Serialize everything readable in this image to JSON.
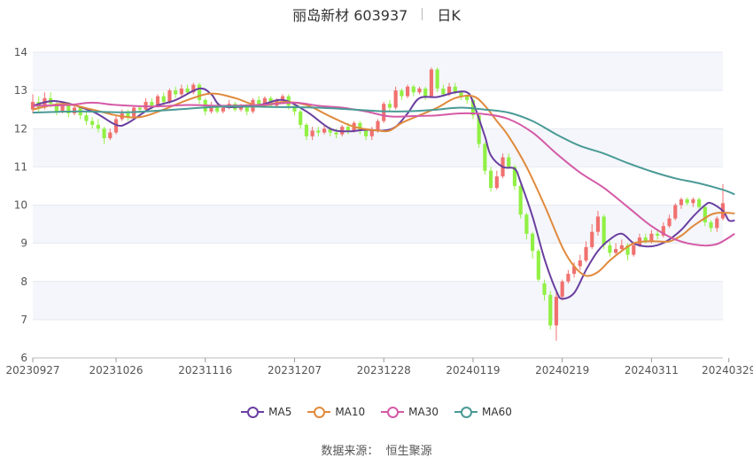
{
  "header": {
    "name": "丽岛新材 603937",
    "period": "日K"
  },
  "source": {
    "label": "数据来源：",
    "value": "恒生聚源"
  },
  "colors": {
    "up": "#f0716f",
    "down": "#91f044",
    "grid": "#e6e9f0",
    "band": "#f4f6fb"
  },
  "chart_data": {
    "type": "candlestick",
    "title": "丽岛新材 603937",
    "ylim": [
      6,
      14
    ],
    "yticks": [
      6,
      7,
      8,
      9,
      10,
      11,
      12,
      13,
      14
    ],
    "x_ticks": [
      "20230927",
      "20231026",
      "20231116",
      "20231207",
      "20231228",
      "20240119",
      "20240219",
      "20240311",
      "20240329"
    ],
    "x_tick_index": [
      0,
      14,
      29,
      44,
      59,
      74,
      89,
      104,
      117
    ],
    "ma_lines": [
      {
        "name": "MA5",
        "color": "#6a3fa0",
        "anchors": [
          [
            0,
            12.6
          ],
          [
            4,
            12.72
          ],
          [
            10,
            12.45
          ],
          [
            14,
            12.1
          ],
          [
            16,
            12.15
          ],
          [
            20,
            12.55
          ],
          [
            24,
            12.75
          ],
          [
            28,
            13.05
          ],
          [
            30,
            12.9
          ],
          [
            32,
            12.58
          ],
          [
            38,
            12.62
          ],
          [
            42,
            12.75
          ],
          [
            46,
            12.45
          ],
          [
            50,
            12.0
          ],
          [
            53,
            11.93
          ],
          [
            56,
            11.97
          ],
          [
            59,
            11.95
          ],
          [
            61,
            12.05
          ],
          [
            63,
            12.4
          ],
          [
            65,
            12.8
          ],
          [
            68,
            12.83
          ],
          [
            71,
            12.95
          ],
          [
            73,
            12.95
          ],
          [
            74,
            12.7
          ],
          [
            76,
            11.8
          ],
          [
            77,
            11.3
          ],
          [
            79,
            11.0
          ],
          [
            81,
            10.95
          ],
          [
            82,
            10.6
          ],
          [
            84,
            9.7
          ],
          [
            86,
            8.6
          ],
          [
            88,
            7.75
          ],
          [
            89,
            7.55
          ],
          [
            91,
            7.7
          ],
          [
            93,
            8.3
          ],
          [
            95,
            8.8
          ],
          [
            97,
            9.1
          ],
          [
            99,
            9.25
          ],
          [
            101,
            9.0
          ],
          [
            103,
            8.92
          ],
          [
            105,
            8.95
          ],
          [
            107,
            9.1
          ],
          [
            109,
            9.35
          ],
          [
            111,
            9.7
          ],
          [
            113,
            10.0
          ],
          [
            114,
            10.05
          ],
          [
            116,
            9.85
          ],
          [
            117,
            9.6
          ],
          [
            118,
            9.6
          ]
        ]
      },
      {
        "name": "MA10",
        "color": "#e08a3c",
        "anchors": [
          [
            0,
            12.5
          ],
          [
            5,
            12.65
          ],
          [
            10,
            12.5
          ],
          [
            14,
            12.35
          ],
          [
            18,
            12.3
          ],
          [
            22,
            12.5
          ],
          [
            26,
            12.75
          ],
          [
            30,
            12.92
          ],
          [
            34,
            12.8
          ],
          [
            38,
            12.6
          ],
          [
            42,
            12.7
          ],
          [
            46,
            12.62
          ],
          [
            50,
            12.32
          ],
          [
            54,
            12.05
          ],
          [
            58,
            11.95
          ],
          [
            60,
            11.95
          ],
          [
            62,
            12.15
          ],
          [
            65,
            12.35
          ],
          [
            68,
            12.55
          ],
          [
            71,
            12.8
          ],
          [
            74,
            12.85
          ],
          [
            76,
            12.6
          ],
          [
            78,
            12.2
          ],
          [
            80,
            11.8
          ],
          [
            83,
            11.0
          ],
          [
            86,
            10.0
          ],
          [
            89,
            8.9
          ],
          [
            91,
            8.4
          ],
          [
            93,
            8.15
          ],
          [
            95,
            8.25
          ],
          [
            97,
            8.55
          ],
          [
            99,
            8.8
          ],
          [
            101,
            9.0
          ],
          [
            103,
            9.05
          ],
          [
            105,
            9.05
          ],
          [
            107,
            9.05
          ],
          [
            109,
            9.2
          ],
          [
            111,
            9.45
          ],
          [
            114,
            9.75
          ],
          [
            116,
            9.8
          ],
          [
            118,
            9.78
          ]
        ]
      },
      {
        "name": "MA30",
        "color": "#d45aa6",
        "anchors": [
          [
            0,
            12.6
          ],
          [
            6,
            12.62
          ],
          [
            10,
            12.68
          ],
          [
            14,
            12.62
          ],
          [
            20,
            12.58
          ],
          [
            26,
            12.62
          ],
          [
            32,
            12.6
          ],
          [
            38,
            12.62
          ],
          [
            44,
            12.68
          ],
          [
            48,
            12.6
          ],
          [
            52,
            12.55
          ],
          [
            56,
            12.45
          ],
          [
            60,
            12.32
          ],
          [
            64,
            12.33
          ],
          [
            68,
            12.35
          ],
          [
            72,
            12.4
          ],
          [
            76,
            12.38
          ],
          [
            80,
            12.25
          ],
          [
            84,
            11.9
          ],
          [
            88,
            11.35
          ],
          [
            92,
            10.85
          ],
          [
            96,
            10.45
          ],
          [
            100,
            9.95
          ],
          [
            104,
            9.45
          ],
          [
            108,
            9.1
          ],
          [
            112,
            8.95
          ],
          [
            115,
            8.98
          ],
          [
            118,
            9.25
          ]
        ]
      },
      {
        "name": "MA60",
        "color": "#4a9a96",
        "anchors": [
          [
            0,
            12.42
          ],
          [
            8,
            12.45
          ],
          [
            16,
            12.43
          ],
          [
            24,
            12.5
          ],
          [
            32,
            12.58
          ],
          [
            40,
            12.57
          ],
          [
            48,
            12.55
          ],
          [
            56,
            12.48
          ],
          [
            60,
            12.45
          ],
          [
            64,
            12.46
          ],
          [
            68,
            12.5
          ],
          [
            72,
            12.55
          ],
          [
            76,
            12.5
          ],
          [
            80,
            12.42
          ],
          [
            84,
            12.2
          ],
          [
            88,
            11.85
          ],
          [
            92,
            11.55
          ],
          [
            96,
            11.35
          ],
          [
            100,
            11.1
          ],
          [
            104,
            10.88
          ],
          [
            108,
            10.7
          ],
          [
            112,
            10.57
          ],
          [
            116,
            10.4
          ],
          [
            118,
            10.28
          ]
        ]
      }
    ],
    "candles": [
      [
        12.5,
        12.7,
        12.9,
        12.4
      ],
      [
        12.7,
        12.55,
        12.85,
        12.4
      ],
      [
        12.55,
        12.8,
        12.95,
        12.5
      ],
      [
        12.8,
        12.65,
        12.95,
        12.55
      ],
      [
        12.65,
        12.45,
        12.75,
        12.35
      ],
      [
        12.45,
        12.6,
        12.7,
        12.4
      ],
      [
        12.6,
        12.4,
        12.7,
        12.3
      ],
      [
        12.4,
        12.55,
        12.65,
        12.35
      ],
      [
        12.55,
        12.35,
        12.6,
        12.25
      ],
      [
        12.35,
        12.2,
        12.45,
        12.1
      ],
      [
        12.2,
        12.1,
        12.3,
        12.0
      ],
      [
        12.1,
        12.0,
        12.25,
        11.9
      ],
      [
        12.0,
        11.75,
        12.05,
        11.6
      ],
      [
        11.75,
        11.9,
        12.0,
        11.7
      ],
      [
        11.9,
        12.25,
        12.35,
        11.85
      ],
      [
        12.25,
        12.4,
        12.5,
        12.2
      ],
      [
        12.4,
        12.3,
        12.5,
        12.2
      ],
      [
        12.3,
        12.55,
        12.6,
        12.25
      ],
      [
        12.55,
        12.5,
        12.6,
        12.4
      ],
      [
        12.5,
        12.7,
        12.8,
        12.45
      ],
      [
        12.7,
        12.6,
        12.8,
        12.5
      ],
      [
        12.6,
        12.85,
        12.9,
        12.55
      ],
      [
        12.85,
        12.7,
        12.95,
        12.6
      ],
      [
        12.7,
        13.0,
        13.05,
        12.65
      ],
      [
        13.0,
        12.9,
        13.1,
        12.8
      ],
      [
        12.9,
        13.05,
        13.15,
        12.85
      ],
      [
        13.05,
        12.95,
        13.15,
        12.9
      ],
      [
        12.95,
        13.15,
        13.2,
        12.9
      ],
      [
        13.15,
        12.75,
        13.2,
        12.65
      ],
      [
        12.75,
        12.45,
        12.8,
        12.35
      ],
      [
        12.45,
        12.6,
        12.7,
        12.4
      ],
      [
        12.6,
        12.45,
        12.7,
        12.4
      ],
      [
        12.45,
        12.55,
        12.6,
        12.4
      ],
      [
        12.55,
        12.65,
        12.75,
        12.5
      ],
      [
        12.65,
        12.5,
        12.7,
        12.45
      ],
      [
        12.5,
        12.6,
        12.65,
        12.45
      ],
      [
        12.6,
        12.45,
        12.65,
        12.35
      ],
      [
        12.45,
        12.75,
        12.8,
        12.4
      ],
      [
        12.75,
        12.6,
        12.85,
        12.55
      ],
      [
        12.6,
        12.8,
        12.85,
        12.55
      ],
      [
        12.8,
        12.6,
        12.85,
        12.55
      ],
      [
        12.6,
        12.75,
        12.8,
        12.55
      ],
      [
        12.75,
        12.85,
        12.9,
        12.7
      ],
      [
        12.85,
        12.6,
        12.9,
        12.5
      ],
      [
        12.6,
        12.45,
        12.7,
        12.35
      ],
      [
        12.45,
        12.1,
        12.5,
        12.0
      ],
      [
        12.1,
        11.8,
        12.15,
        11.7
      ],
      [
        11.8,
        11.95,
        12.05,
        11.7
      ],
      [
        11.95,
        11.9,
        12.05,
        11.8
      ],
      [
        11.9,
        12.0,
        12.1,
        11.85
      ],
      [
        12.0,
        11.9,
        12.05,
        11.8
      ],
      [
        11.9,
        11.85,
        12.0,
        11.75
      ],
      [
        11.85,
        12.05,
        12.1,
        11.8
      ],
      [
        12.05,
        11.95,
        12.15,
        11.85
      ],
      [
        11.95,
        12.15,
        12.2,
        11.9
      ],
      [
        12.15,
        11.95,
        12.2,
        11.85
      ],
      [
        11.95,
        11.8,
        12.0,
        11.7
      ],
      [
        11.8,
        11.95,
        12.05,
        11.7
      ],
      [
        11.95,
        12.2,
        12.25,
        11.9
      ],
      [
        12.2,
        12.65,
        12.7,
        12.15
      ],
      [
        12.65,
        12.55,
        12.75,
        12.45
      ],
      [
        12.55,
        13.0,
        13.1,
        12.5
      ],
      [
        13.0,
        12.85,
        13.05,
        12.75
      ],
      [
        12.85,
        13.1,
        13.15,
        12.8
      ],
      [
        13.1,
        12.95,
        13.15,
        12.85
      ],
      [
        12.95,
        13.05,
        13.1,
        12.9
      ],
      [
        13.05,
        12.85,
        13.1,
        12.75
      ],
      [
        12.85,
        13.55,
        13.6,
        12.8
      ],
      [
        13.55,
        13.05,
        13.6,
        12.95
      ],
      [
        13.05,
        12.9,
        13.15,
        12.85
      ],
      [
        12.9,
        13.1,
        13.2,
        12.85
      ],
      [
        13.1,
        12.95,
        13.2,
        12.9
      ],
      [
        12.95,
        12.85,
        13.0,
        12.75
      ],
      [
        12.85,
        12.75,
        12.9,
        12.65
      ],
      [
        12.75,
        12.35,
        12.8,
        12.25
      ],
      [
        12.35,
        11.6,
        12.4,
        11.5
      ],
      [
        11.6,
        10.9,
        11.65,
        10.8
      ],
      [
        10.9,
        10.45,
        11.0,
        10.35
      ],
      [
        10.45,
        10.75,
        10.9,
        10.4
      ],
      [
        10.75,
        11.25,
        11.35,
        10.7
      ],
      [
        11.25,
        11.0,
        11.35,
        10.95
      ],
      [
        11.0,
        10.5,
        11.05,
        10.4
      ],
      [
        10.5,
        9.75,
        10.55,
        9.65
      ],
      [
        9.75,
        9.25,
        9.8,
        9.1
      ],
      [
        9.25,
        8.8,
        9.3,
        8.6
      ],
      [
        8.8,
        8.05,
        8.85,
        8.0
      ],
      [
        7.95,
        7.65,
        8.05,
        7.5
      ],
      [
        7.65,
        6.85,
        7.75,
        6.75
      ],
      [
        6.85,
        7.6,
        7.75,
        6.45
      ],
      [
        7.6,
        8.0,
        8.05,
        7.5
      ],
      [
        8.0,
        8.2,
        8.3,
        7.95
      ],
      [
        8.2,
        8.4,
        8.5,
        8.1
      ],
      [
        8.4,
        8.55,
        8.7,
        8.3
      ],
      [
        8.55,
        8.9,
        9.05,
        8.5
      ],
      [
        8.9,
        9.3,
        9.5,
        8.85
      ],
      [
        9.3,
        9.7,
        9.85,
        9.2
      ],
      [
        9.7,
        8.95,
        9.75,
        8.85
      ],
      [
        8.95,
        8.75,
        9.05,
        8.65
      ],
      [
        8.75,
        8.85,
        9.0,
        8.7
      ],
      [
        8.85,
        8.95,
        9.1,
        8.8
      ],
      [
        8.95,
        8.7,
        9.0,
        8.55
      ],
      [
        8.7,
        8.95,
        9.0,
        8.65
      ],
      [
        8.95,
        9.15,
        9.25,
        8.9
      ],
      [
        9.15,
        9.05,
        9.25,
        9.0
      ],
      [
        9.05,
        9.25,
        9.35,
        9.0
      ],
      [
        9.25,
        9.2,
        9.35,
        9.1
      ],
      [
        9.2,
        9.45,
        9.55,
        9.15
      ],
      [
        9.45,
        9.65,
        9.75,
        9.4
      ],
      [
        9.65,
        10.0,
        10.05,
        9.6
      ],
      [
        10.0,
        10.15,
        10.2,
        9.9
      ],
      [
        10.15,
        10.05,
        10.2,
        10.0
      ],
      [
        10.05,
        10.15,
        10.2,
        9.95
      ],
      [
        10.15,
        9.95,
        10.2,
        9.9
      ],
      [
        9.95,
        9.55,
        10.0,
        9.45
      ],
      [
        9.55,
        9.4,
        9.6,
        9.3
      ],
      [
        9.4,
        9.65,
        9.7,
        9.3
      ],
      [
        9.65,
        10.05,
        10.55,
        9.6
      ]
    ]
  }
}
